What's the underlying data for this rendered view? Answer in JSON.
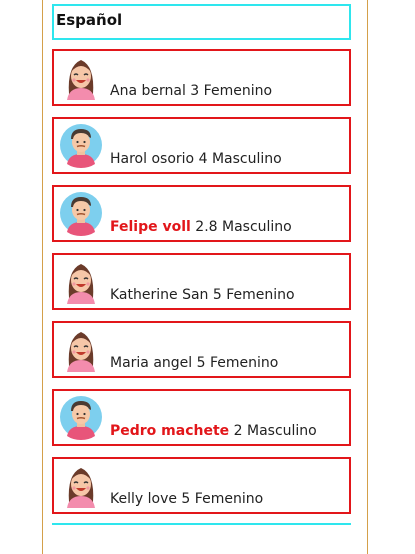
{
  "section": {
    "title": "Español"
  },
  "students": [
    {
      "name": "Ana bernal",
      "grade": "3",
      "gender": "Femenino",
      "highlight": false,
      "avatar": "female-avatar-icon"
    },
    {
      "name": "Harol osorio",
      "grade": "4",
      "gender": "Masculino",
      "highlight": false,
      "avatar": "male-avatar-icon"
    },
    {
      "name": "Felipe voll",
      "grade": "2.8",
      "gender": "Masculino",
      "highlight": true,
      "avatar": "male-avatar-icon"
    },
    {
      "name": "Katherine San",
      "grade": "5",
      "gender": "Femenino",
      "highlight": false,
      "avatar": "female-avatar-icon"
    },
    {
      "name": "Maria angel",
      "grade": "5",
      "gender": "Femenino",
      "highlight": false,
      "avatar": "female-avatar-icon"
    },
    {
      "name": "Pedro machete",
      "grade": "2",
      "gender": "Masculino",
      "highlight": true,
      "avatar": "male-avatar-icon"
    },
    {
      "name": "Kelly love",
      "grade": "5",
      "gender": "Femenino",
      "highlight": false,
      "avatar": "female-avatar-icon"
    }
  ],
  "colors": {
    "card_border": "#e2161a",
    "header_border": "#2ee6ee",
    "highlight_text": "#e2161a",
    "frame_line": "#d4a04a"
  }
}
